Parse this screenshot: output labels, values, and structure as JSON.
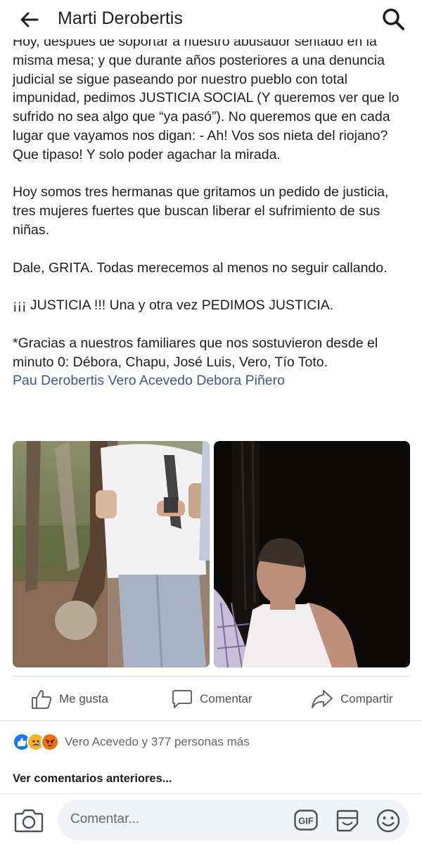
{
  "header": {
    "title": "Marti Derobertis",
    "back_icon": "arrow-left-icon",
    "search_icon": "search-icon"
  },
  "post": {
    "paragraphs": [
      "Hoy, después de soportar a nuestro abusador sentado en la misma mesa; y que durante años posteriores a una denuncia judicial se sigue paseando por nuestro pueblo con total impunidad, pedimos JUSTICIA SOCIAL (Y queremos ver que lo sufrido no sea algo que “ya pasó”). No queremos que en cada lugar que vayamos nos digan: - Ah! Vos sos nieta del riojano? Que tipaso! Y solo poder agachar la mirada.",
      "Hoy somos tres hermanas que gritamos un pedido de justicia, tres mujeres fuertes que buscan liberar el sufrimiento de sus niñas.",
      "Dale, GRITA. Todas merecemos al menos no seguir callando.",
      "¡¡¡ JUSTICIA !!! Una y otra vez PEDIMOS JUSTICIA.",
      "*Gracias a nuestros familiares que nos sostuvieron desde el minuto 0: Débora, Chapu, José Luis, Vero, Tío Toto."
    ],
    "tags": [
      "Pau Derobertis",
      "Vero Acevedo",
      "Debora Piñero"
    ]
  },
  "actions": {
    "like": "Me gusta",
    "comment": "Comentar",
    "share": "Compartir"
  },
  "reactions": {
    "icons": [
      "like-reaction-icon",
      "sad-reaction-icon",
      "angry-reaction-icon"
    ],
    "text": "Vero Acevedo y 377 personas más"
  },
  "comments": {
    "previous_label": "Ver comentarios anteriores..."
  },
  "composer": {
    "placeholder": "Comentar...",
    "gif_label": "GIF"
  },
  "colors": {
    "link": "#385898",
    "like_blue": "#1877f2",
    "sad_yellow": "#f7b125",
    "angry_red": "#e9710f"
  }
}
